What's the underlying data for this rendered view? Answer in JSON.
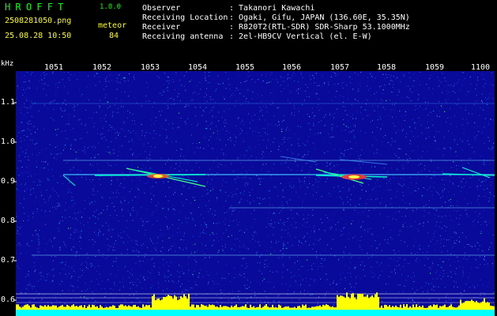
{
  "header": {
    "logo_text": "HROFFT",
    "version": "1.0.0",
    "filename": "2508281050.png",
    "datetime": "25.08.28 10:50",
    "meteor_label": "meteor",
    "meteor_count": "84",
    "rows": [
      {
        "label": "Observer",
        "value": ": Takanori Kawachi"
      },
      {
        "label": "Receiving Location",
        "value": ": Ogaki, Gifu, JAPAN (136.60E, 35.35N)"
      },
      {
        "label": "Receiver",
        "value": ": R820T2(RTL-SDR) SDR-Sharp 53.1000MHz"
      },
      {
        "label": "Receiving antenna",
        "value": ": 2el-HB9CV Vertical (el. E-W)"
      }
    ]
  },
  "spectrogram": {
    "y_unit": "kHz",
    "x_ticks": [
      "1051",
      "1052",
      "1053",
      "1054",
      "1055",
      "1056",
      "1057",
      "1058",
      "1059",
      "1100"
    ],
    "y_ticks": [
      "1.1",
      "1.0",
      "0.9",
      "0.8",
      "0.7",
      "0.6"
    ],
    "colors": {
      "background": "#0a0a9a",
      "noise": "#3a5cff",
      "signal": "#00e0ff",
      "hot": "#ff3030",
      "bar": "#ffff00",
      "base": "#00ffff",
      "axis": "#ffffff"
    }
  }
}
